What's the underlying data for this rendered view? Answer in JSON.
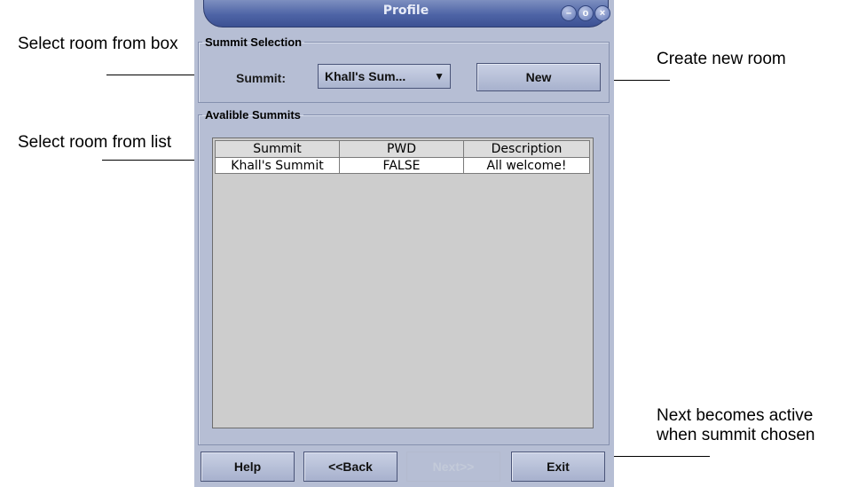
{
  "window": {
    "title": "Profile",
    "controls": [
      "minimize-icon",
      "restore-icon",
      "close-icon"
    ]
  },
  "summit_selection": {
    "group_label": "Summit Selection",
    "summit_label": "Summit:",
    "selected_value": "Khall's Sum...",
    "new_button": "New"
  },
  "available_summits": {
    "group_label": "Avalible Summits",
    "columns": [
      "Summit",
      "PWD",
      "Description"
    ],
    "rows": [
      [
        "Khall's Summit",
        "FALSE",
        "All welcome!"
      ]
    ]
  },
  "footer": {
    "help": "Help",
    "back": "<<Back",
    "next": "Next>>",
    "exit": "Exit"
  },
  "annotations": {
    "select_box": "Select room from box",
    "create_new": "Create new room",
    "select_list": "Select room from list",
    "next_active": "Next becomes active when summit chosen"
  }
}
